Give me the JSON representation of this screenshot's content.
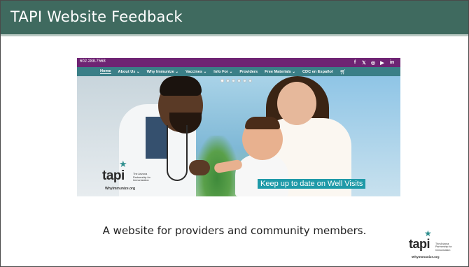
{
  "slide": {
    "title": "TAPI Website Feedback",
    "caption": "A website for providers and community members.",
    "colors": {
      "title_bar": "#3f6a5f",
      "accent": "#1f9aa8"
    }
  },
  "website": {
    "phone": "602.288.7568",
    "social_icons": [
      {
        "name": "facebook-icon",
        "glyph": "f"
      },
      {
        "name": "twitter-icon",
        "glyph": "𝕏"
      },
      {
        "name": "instagram-icon",
        "glyph": "◎"
      },
      {
        "name": "youtube-icon",
        "glyph": "▶"
      },
      {
        "name": "linkedin-icon",
        "glyph": "in"
      }
    ],
    "nav": {
      "home": "Home",
      "about": "About Us ⌄",
      "why": "Why Immunize ⌄",
      "vaccines": "Vaccines ⌄",
      "info": "Info For ⌄",
      "providers": "Providers",
      "materials": "Free Materials ⌄",
      "cdc": "CDC en Español",
      "cart_icon": "cart-icon"
    },
    "hero": {
      "banner": "Keep up to date on Well Visits",
      "logo_word": "tapi",
      "logo_tagline": "The Arizona Partnership for Immunization",
      "logo_url": "WhyImmunize.org"
    }
  },
  "corner_logo": {
    "word": "tapi",
    "tagline": "The Arizona Partnership for Immunization",
    "url": "WhyImmunize.org"
  }
}
